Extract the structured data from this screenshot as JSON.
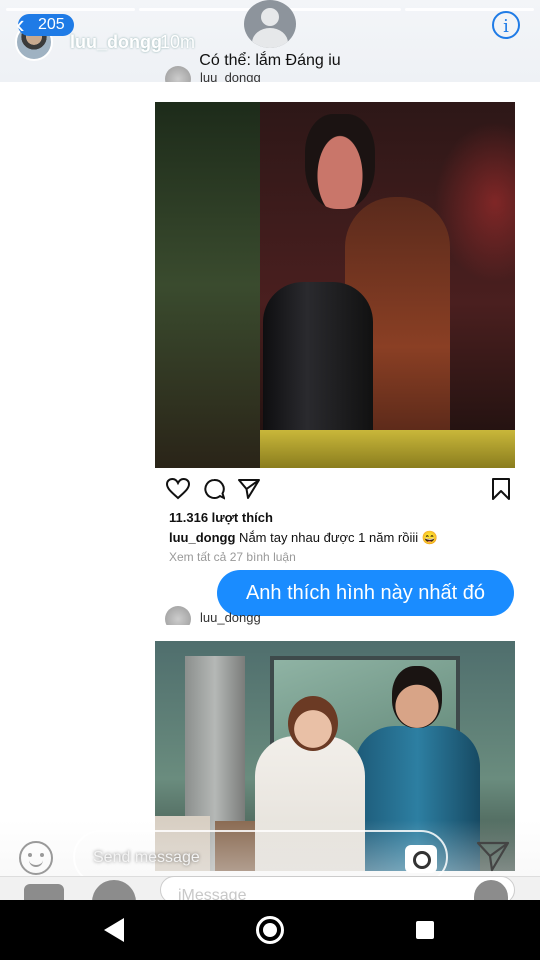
{
  "story_header": {
    "back_count": "205",
    "username": "luu_dongg",
    "time_ago": "10m",
    "subtitle": "Có thể: lắm Đáng iu",
    "info_icon": "info-icon"
  },
  "post1": {
    "author": "luu_dongg",
    "likes": "11.316 lượt thích",
    "caption_user": "luu_dongg",
    "caption_text": " Nắm tay nhau được 1 năm rồiii 😄",
    "view_comments": "Xem tất cả 27 bình luận"
  },
  "reply_bubble": {
    "text": "Anh thích hình này nhất đó"
  },
  "post2": {
    "author": "luu_dongg"
  },
  "send_bar": {
    "placeholder": "Send message"
  },
  "imessage_bar": {
    "placeholder": "iMessage"
  },
  "colors": {
    "accent": "#1f7be6",
    "bubble": "#1a8cff"
  }
}
